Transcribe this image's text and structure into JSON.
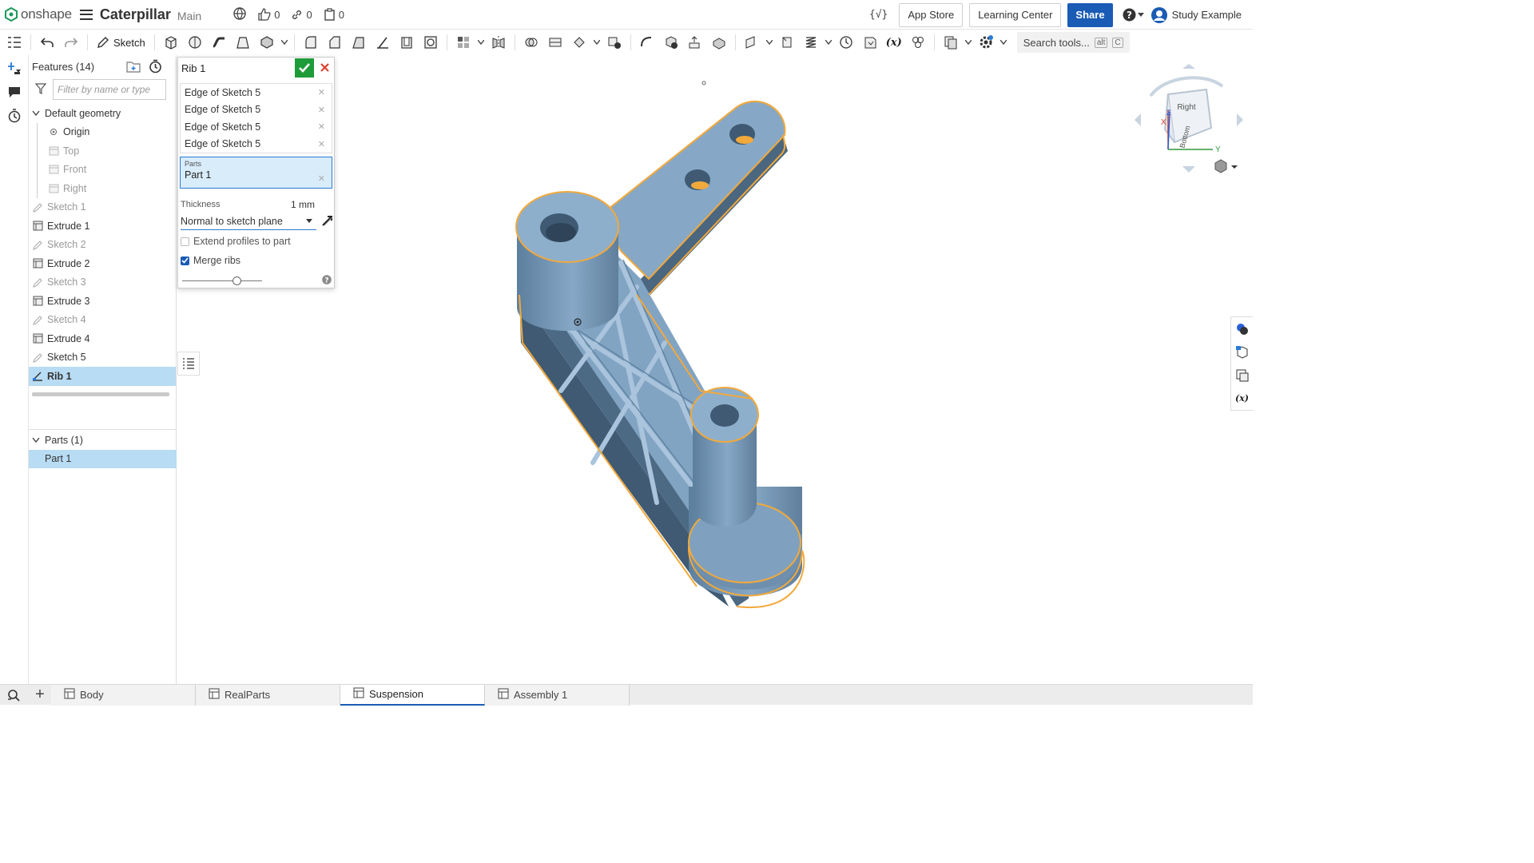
{
  "brand": {
    "name": "onshape"
  },
  "document": {
    "name": "Caterpillar",
    "workspace": "Main"
  },
  "stats": {
    "likes": "0",
    "links": "0",
    "copies": "0"
  },
  "header": {
    "app_store": "App Store",
    "learning_center": "Learning Center",
    "share": "Share",
    "user": "Study Example"
  },
  "toolbar": {
    "sketch_label": "Sketch",
    "search_placeholder": "Search tools...",
    "search_shortcut_mod": "alt",
    "search_shortcut_key": "C"
  },
  "features": {
    "title": "Features (14)",
    "filter_placeholder": "Filter by name or type",
    "default_geometry": "Default geometry",
    "items": [
      {
        "label": "Origin",
        "state": "normal",
        "icon": "origin-icon"
      },
      {
        "label": "Top",
        "state": "muted",
        "icon": "plane-icon"
      },
      {
        "label": "Front",
        "state": "muted",
        "icon": "plane-icon"
      },
      {
        "label": "Right",
        "state": "muted",
        "icon": "plane-icon"
      },
      {
        "label": "Sketch 1",
        "state": "muted",
        "icon": "sketch-icon"
      },
      {
        "label": "Extrude 1",
        "state": "normal",
        "icon": "extrude-icon"
      },
      {
        "label": "Sketch 2",
        "state": "muted",
        "icon": "sketch-icon"
      },
      {
        "label": "Extrude 2",
        "state": "normal",
        "icon": "extrude-icon"
      },
      {
        "label": "Sketch 3",
        "state": "muted",
        "icon": "sketch-icon"
      },
      {
        "label": "Extrude 3",
        "state": "normal",
        "icon": "extrude-icon"
      },
      {
        "label": "Sketch 4",
        "state": "muted",
        "icon": "sketch-icon"
      },
      {
        "label": "Extrude 4",
        "state": "normal",
        "icon": "extrude-icon"
      },
      {
        "label": "Sketch 5",
        "state": "normal",
        "icon": "sketch-icon"
      },
      {
        "label": "Rib 1",
        "state": "selected",
        "icon": "rib-icon"
      }
    ],
    "parts_title": "Parts (1)",
    "parts": [
      "Part 1"
    ]
  },
  "rib_dialog": {
    "title": "Rib 1",
    "edges": [
      "Edge of Sketch 5",
      "Edge of Sketch 5",
      "Edge of Sketch 5",
      "Edge of Sketch 5"
    ],
    "parts_label": "Parts",
    "parts_value": "Part 1",
    "thickness_label": "Thickness",
    "thickness_value": "1 mm",
    "direction": "Normal to sketch plane",
    "extend_label": "Extend profiles to part",
    "extend_checked": false,
    "merge_label": "Merge ribs",
    "merge_checked": true,
    "slider_fraction": 0.68
  },
  "viewcube": {
    "face_top": "Right",
    "face_front": "Bottom",
    "axis_x": "X",
    "axis_y": "Y",
    "axis_z": "Z"
  },
  "tabs": [
    {
      "label": "Body",
      "active": false
    },
    {
      "label": "RealParts",
      "active": false
    },
    {
      "label": "Suspension",
      "active": true
    },
    {
      "label": "Assembly 1",
      "active": false
    }
  ],
  "colors": {
    "accent": "#1a5bb5",
    "confirm": "#1f9c3a",
    "cancel": "#d9432f",
    "part_fill": "#7fa4c4",
    "selection": "#f2a93b"
  }
}
